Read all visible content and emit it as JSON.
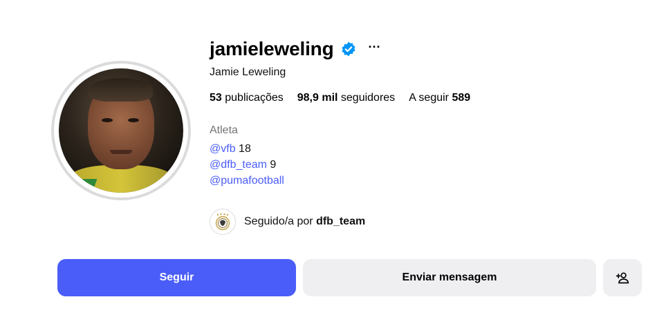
{
  "profile": {
    "username": "jamieleweling",
    "full_name": "Jamie Leweling",
    "verified": true,
    "more_label": "···",
    "category": "Atleta"
  },
  "stats": {
    "posts_count": "53",
    "posts_label": "publicações",
    "followers_count": "98,9 mil",
    "followers_label": "seguidores",
    "following_label": "A seguir",
    "following_count": "589"
  },
  "bio": {
    "lines": [
      {
        "mention": "@vfb",
        "suffix": " 18"
      },
      {
        "mention": "@dfb_team",
        "suffix": " 9"
      },
      {
        "mention": "@pumafootball",
        "suffix": ""
      }
    ]
  },
  "followed_by": {
    "prefix": "Seguido/a por ",
    "account": "dfb_team"
  },
  "actions": {
    "follow_label": "Seguir",
    "message_label": "Enviar mensagem",
    "suggest_icon": "add-person-icon"
  },
  "colors": {
    "accent": "#4a5df9",
    "verified_badge": "#0095f6",
    "secondary_button": "#efeff2",
    "muted_text": "#737373"
  }
}
